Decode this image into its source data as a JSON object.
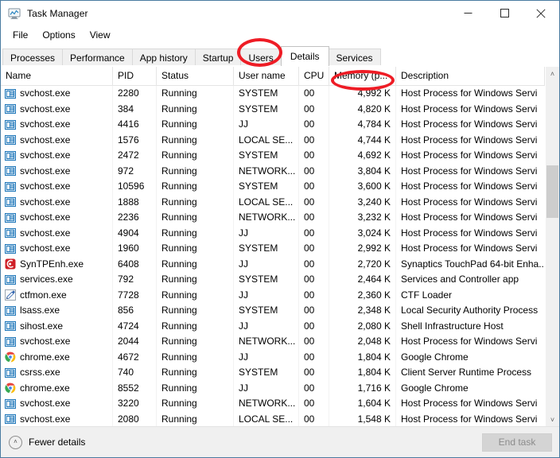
{
  "window": {
    "title": "Task Manager",
    "icon": "task-manager-icon",
    "minimize_label": "—",
    "maximize_label": "□",
    "close_label": "✕"
  },
  "menu": {
    "items": [
      {
        "label": "File"
      },
      {
        "label": "Options"
      },
      {
        "label": "View"
      }
    ]
  },
  "tabs": {
    "items": [
      {
        "label": "Processes",
        "active": false
      },
      {
        "label": "Performance",
        "active": false
      },
      {
        "label": "App history",
        "active": false
      },
      {
        "label": "Startup",
        "active": false
      },
      {
        "label": "Users",
        "active": false
      },
      {
        "label": "Details",
        "active": true
      },
      {
        "label": "Services",
        "active": false
      }
    ]
  },
  "annotations": {
    "color": "#ee1c25",
    "items": [
      {
        "target": "tab-details",
        "shape": "oval"
      },
      {
        "target": "column-header-memory",
        "shape": "oval"
      }
    ]
  },
  "table": {
    "sort": {
      "column": "Memory (p...",
      "direction": "descending",
      "chevron": "⌄"
    },
    "columns": [
      {
        "key": "name",
        "label": "Name",
        "align": "left"
      },
      {
        "key": "pid",
        "label": "PID",
        "align": "left"
      },
      {
        "key": "status",
        "label": "Status",
        "align": "left"
      },
      {
        "key": "user",
        "label": "User name",
        "align": "left"
      },
      {
        "key": "cpu",
        "label": "CPU",
        "align": "left"
      },
      {
        "key": "memory",
        "label": "Memory (p...",
        "align": "right"
      },
      {
        "key": "description",
        "label": "Description",
        "align": "left"
      }
    ],
    "rows": [
      {
        "icon": "service-host-icon",
        "name": "svchost.exe",
        "pid": "2280",
        "status": "Running",
        "user": "SYSTEM",
        "cpu": "00",
        "memory": "4,992 K",
        "description": "Host Process for Windows Servi"
      },
      {
        "icon": "service-host-icon",
        "name": "svchost.exe",
        "pid": "384",
        "status": "Running",
        "user": "SYSTEM",
        "cpu": "00",
        "memory": "4,820 K",
        "description": "Host Process for Windows Servi"
      },
      {
        "icon": "service-host-icon",
        "name": "svchost.exe",
        "pid": "4416",
        "status": "Running",
        "user": "JJ",
        "cpu": "00",
        "memory": "4,784 K",
        "description": "Host Process for Windows Servi"
      },
      {
        "icon": "service-host-icon",
        "name": "svchost.exe",
        "pid": "1576",
        "status": "Running",
        "user": "LOCAL SE...",
        "cpu": "00",
        "memory": "4,744 K",
        "description": "Host Process for Windows Servi"
      },
      {
        "icon": "service-host-icon",
        "name": "svchost.exe",
        "pid": "2472",
        "status": "Running",
        "user": "SYSTEM",
        "cpu": "00",
        "memory": "4,692 K",
        "description": "Host Process for Windows Servi"
      },
      {
        "icon": "service-host-icon",
        "name": "svchost.exe",
        "pid": "972",
        "status": "Running",
        "user": "NETWORK...",
        "cpu": "00",
        "memory": "3,804 K",
        "description": "Host Process for Windows Servi"
      },
      {
        "icon": "service-host-icon",
        "name": "svchost.exe",
        "pid": "10596",
        "status": "Running",
        "user": "SYSTEM",
        "cpu": "00",
        "memory": "3,600 K",
        "description": "Host Process for Windows Servi"
      },
      {
        "icon": "service-host-icon",
        "name": "svchost.exe",
        "pid": "1888",
        "status": "Running",
        "user": "LOCAL SE...",
        "cpu": "00",
        "memory": "3,240 K",
        "description": "Host Process for Windows Servi"
      },
      {
        "icon": "service-host-icon",
        "name": "svchost.exe",
        "pid": "2236",
        "status": "Running",
        "user": "NETWORK...",
        "cpu": "00",
        "memory": "3,232 K",
        "description": "Host Process for Windows Servi"
      },
      {
        "icon": "service-host-icon",
        "name": "svchost.exe",
        "pid": "4904",
        "status": "Running",
        "user": "JJ",
        "cpu": "00",
        "memory": "3,024 K",
        "description": "Host Process for Windows Servi"
      },
      {
        "icon": "service-host-icon",
        "name": "svchost.exe",
        "pid": "1960",
        "status": "Running",
        "user": "SYSTEM",
        "cpu": "00",
        "memory": "2,992 K",
        "description": "Host Process for Windows Servi"
      },
      {
        "icon": "synaptics-icon",
        "name": "SynTPEnh.exe",
        "pid": "6408",
        "status": "Running",
        "user": "JJ",
        "cpu": "00",
        "memory": "2,720 K",
        "description": "Synaptics TouchPad 64-bit Enha..."
      },
      {
        "icon": "service-host-icon",
        "name": "services.exe",
        "pid": "792",
        "status": "Running",
        "user": "SYSTEM",
        "cpu": "00",
        "memory": "2,464 K",
        "description": "Services and Controller app"
      },
      {
        "icon": "ctfmon-pen-icon",
        "name": "ctfmon.exe",
        "pid": "7728",
        "status": "Running",
        "user": "JJ",
        "cpu": "00",
        "memory": "2,360 K",
        "description": "CTF Loader"
      },
      {
        "icon": "service-host-icon",
        "name": "lsass.exe",
        "pid": "856",
        "status": "Running",
        "user": "SYSTEM",
        "cpu": "00",
        "memory": "2,348 K",
        "description": "Local Security Authority Process"
      },
      {
        "icon": "service-host-icon",
        "name": "sihost.exe",
        "pid": "4724",
        "status": "Running",
        "user": "JJ",
        "cpu": "00",
        "memory": "2,080 K",
        "description": "Shell Infrastructure Host"
      },
      {
        "icon": "service-host-icon",
        "name": "svchost.exe",
        "pid": "2044",
        "status": "Running",
        "user": "NETWORK...",
        "cpu": "00",
        "memory": "2,048 K",
        "description": "Host Process for Windows Servi"
      },
      {
        "icon": "chrome-icon",
        "name": "chrome.exe",
        "pid": "4672",
        "status": "Running",
        "user": "JJ",
        "cpu": "00",
        "memory": "1,804 K",
        "description": "Google Chrome"
      },
      {
        "icon": "service-host-icon",
        "name": "csrss.exe",
        "pid": "740",
        "status": "Running",
        "user": "SYSTEM",
        "cpu": "00",
        "memory": "1,804 K",
        "description": "Client Server Runtime Process"
      },
      {
        "icon": "chrome-icon",
        "name": "chrome.exe",
        "pid": "8552",
        "status": "Running",
        "user": "JJ",
        "cpu": "00",
        "memory": "1,716 K",
        "description": "Google Chrome"
      },
      {
        "icon": "service-host-icon",
        "name": "svchost.exe",
        "pid": "3220",
        "status": "Running",
        "user": "NETWORK...",
        "cpu": "00",
        "memory": "1,604 K",
        "description": "Host Process for Windows Servi"
      },
      {
        "icon": "service-host-icon",
        "name": "svchost.exe",
        "pid": "2080",
        "status": "Running",
        "user": "LOCAL SE...",
        "cpu": "00",
        "memory": "1,548 K",
        "description": "Host Process for Windows Servi"
      }
    ]
  },
  "scrollbar": {
    "up_arrow": "˄",
    "down_arrow": "˅"
  },
  "statusbar": {
    "fewer_details_label": "Fewer details",
    "fewer_details_icon": "chevron-up-circle-icon",
    "fewer_details_chevron": "˄",
    "end_task_label": "End task",
    "end_task_enabled": false
  }
}
